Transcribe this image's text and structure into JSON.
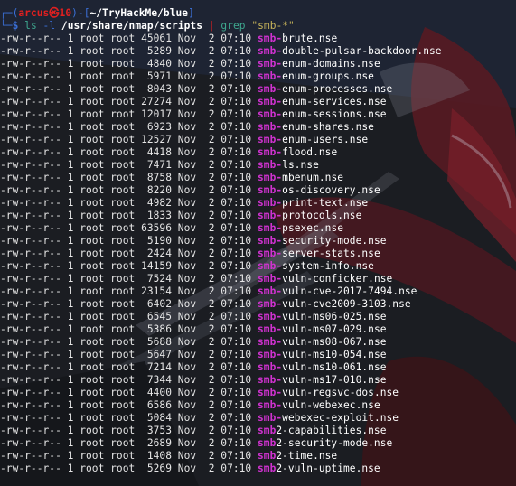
{
  "prompt": {
    "frame_top": "┌─(",
    "user": "arcus",
    "skull": "㉿",
    "host": "10",
    "frame_mid": ")-[",
    "path": "~/TryHackMe/blue",
    "frame_end": "]",
    "frame_bottom": "└─",
    "dollar": "$",
    "command": "ls",
    "flag": "-l",
    "argument": "/usr/share/nmap/scripts",
    "pipe": "|",
    "grep": "grep",
    "pattern": "\"smb-*\""
  },
  "files": [
    {
      "perm": "-rw-r--r--",
      "meta": " 1 root root 45061 Nov  2 07:10 ",
      "match": "smb-",
      "rest": "brute.nse"
    },
    {
      "perm": "-rw-r--r--",
      "meta": " 1 root root  5289 Nov  2 07:10 ",
      "match": "smb-",
      "rest": "double-pulsar-backdoor.nse"
    },
    {
      "perm": "-rw-r--r--",
      "meta": " 1 root root  4840 Nov  2 07:10 ",
      "match": "smb-",
      "rest": "enum-domains.nse"
    },
    {
      "perm": "-rw-r--r--",
      "meta": " 1 root root  5971 Nov  2 07:10 ",
      "match": "smb-",
      "rest": "enum-groups.nse"
    },
    {
      "perm": "-rw-r--r--",
      "meta": " 1 root root  8043 Nov  2 07:10 ",
      "match": "smb-",
      "rest": "enum-processes.nse"
    },
    {
      "perm": "-rw-r--r--",
      "meta": " 1 root root 27274 Nov  2 07:10 ",
      "match": "smb-",
      "rest": "enum-services.nse"
    },
    {
      "perm": "-rw-r--r--",
      "meta": " 1 root root 12017 Nov  2 07:10 ",
      "match": "smb-",
      "rest": "enum-sessions.nse"
    },
    {
      "perm": "-rw-r--r--",
      "meta": " 1 root root  6923 Nov  2 07:10 ",
      "match": "smb-",
      "rest": "enum-shares.nse"
    },
    {
      "perm": "-rw-r--r--",
      "meta": " 1 root root 12527 Nov  2 07:10 ",
      "match": "smb-",
      "rest": "enum-users.nse"
    },
    {
      "perm": "-rw-r--r--",
      "meta": " 1 root root  4418 Nov  2 07:10 ",
      "match": "smb-",
      "rest": "flood.nse"
    },
    {
      "perm": "-rw-r--r--",
      "meta": " 1 root root  7471 Nov  2 07:10 ",
      "match": "smb-",
      "rest": "ls.nse"
    },
    {
      "perm": "-rw-r--r--",
      "meta": " 1 root root  8758 Nov  2 07:10 ",
      "match": "smb-",
      "rest": "mbenum.nse"
    },
    {
      "perm": "-rw-r--r--",
      "meta": " 1 root root  8220 Nov  2 07:10 ",
      "match": "smb-",
      "rest": "os-discovery.nse"
    },
    {
      "perm": "-rw-r--r--",
      "meta": " 1 root root  4982 Nov  2 07:10 ",
      "match": "smb-",
      "rest": "print-text.nse"
    },
    {
      "perm": "-rw-r--r--",
      "meta": " 1 root root  1833 Nov  2 07:10 ",
      "match": "smb-",
      "rest": "protocols.nse"
    },
    {
      "perm": "-rw-r--r--",
      "meta": " 1 root root 63596 Nov  2 07:10 ",
      "match": "smb-",
      "rest": "psexec.nse"
    },
    {
      "perm": "-rw-r--r--",
      "meta": " 1 root root  5190 Nov  2 07:10 ",
      "match": "smb-",
      "rest": "security-mode.nse"
    },
    {
      "perm": "-rw-r--r--",
      "meta": " 1 root root  2424 Nov  2 07:10 ",
      "match": "smb-",
      "rest": "server-stats.nse"
    },
    {
      "perm": "-rw-r--r--",
      "meta": " 1 root root 14159 Nov  2 07:10 ",
      "match": "smb-",
      "rest": "system-info.nse"
    },
    {
      "perm": "-rw-r--r--",
      "meta": " 1 root root  7524 Nov  2 07:10 ",
      "match": "smb-",
      "rest": "vuln-conficker.nse"
    },
    {
      "perm": "-rw-r--r--",
      "meta": " 1 root root 23154 Nov  2 07:10 ",
      "match": "smb-",
      "rest": "vuln-cve-2017-7494.nse"
    },
    {
      "perm": "-rw-r--r--",
      "meta": " 1 root root  6402 Nov  2 07:10 ",
      "match": "smb-",
      "rest": "vuln-cve2009-3103.nse"
    },
    {
      "perm": "-rw-r--r--",
      "meta": " 1 root root  6545 Nov  2 07:10 ",
      "match": "smb-",
      "rest": "vuln-ms06-025.nse"
    },
    {
      "perm": "-rw-r--r--",
      "meta": " 1 root root  5386 Nov  2 07:10 ",
      "match": "smb-",
      "rest": "vuln-ms07-029.nse"
    },
    {
      "perm": "-rw-r--r--",
      "meta": " 1 root root  5688 Nov  2 07:10 ",
      "match": "smb-",
      "rest": "vuln-ms08-067.nse"
    },
    {
      "perm": "-rw-r--r--",
      "meta": " 1 root root  5647 Nov  2 07:10 ",
      "match": "smb-",
      "rest": "vuln-ms10-054.nse"
    },
    {
      "perm": "-rw-r--r--",
      "meta": " 1 root root  7214 Nov  2 07:10 ",
      "match": "smb-",
      "rest": "vuln-ms10-061.nse"
    },
    {
      "perm": "-rw-r--r--",
      "meta": " 1 root root  7344 Nov  2 07:10 ",
      "match": "smb-",
      "rest": "vuln-ms17-010.nse"
    },
    {
      "perm": "-rw-r--r--",
      "meta": " 1 root root  4400 Nov  2 07:10 ",
      "match": "smb-",
      "rest": "vuln-regsvc-dos.nse"
    },
    {
      "perm": "-rw-r--r--",
      "meta": " 1 root root  6586 Nov  2 07:10 ",
      "match": "smb-",
      "rest": "vuln-webexec.nse"
    },
    {
      "perm": "-rw-r--r--",
      "meta": " 1 root root  5084 Nov  2 07:10 ",
      "match": "smb-",
      "rest": "webexec-exploit.nse"
    },
    {
      "perm": "-rw-r--r--",
      "meta": " 1 root root  3753 Nov  2 07:10 ",
      "match": "smb",
      "rest": "2-capabilities.nse"
    },
    {
      "perm": "-rw-r--r--",
      "meta": " 1 root root  2689 Nov  2 07:10 ",
      "match": "smb",
      "rest": "2-security-mode.nse"
    },
    {
      "perm": "-rw-r--r--",
      "meta": " 1 root root  1408 Nov  2 07:10 ",
      "match": "smb",
      "rest": "2-time.nse"
    },
    {
      "perm": "-rw-r--r--",
      "meta": " 1 root root  5269 Nov  2 07:10 ",
      "match": "smb",
      "rest": "2-vuln-uptime.nse"
    }
  ],
  "colors": {
    "background": "#1b1d22",
    "match": "#d132d1",
    "prompt_frame": "#3b6fd6",
    "user": "#e02020",
    "command": "#3ea88f",
    "string": "#c8b45a"
  }
}
